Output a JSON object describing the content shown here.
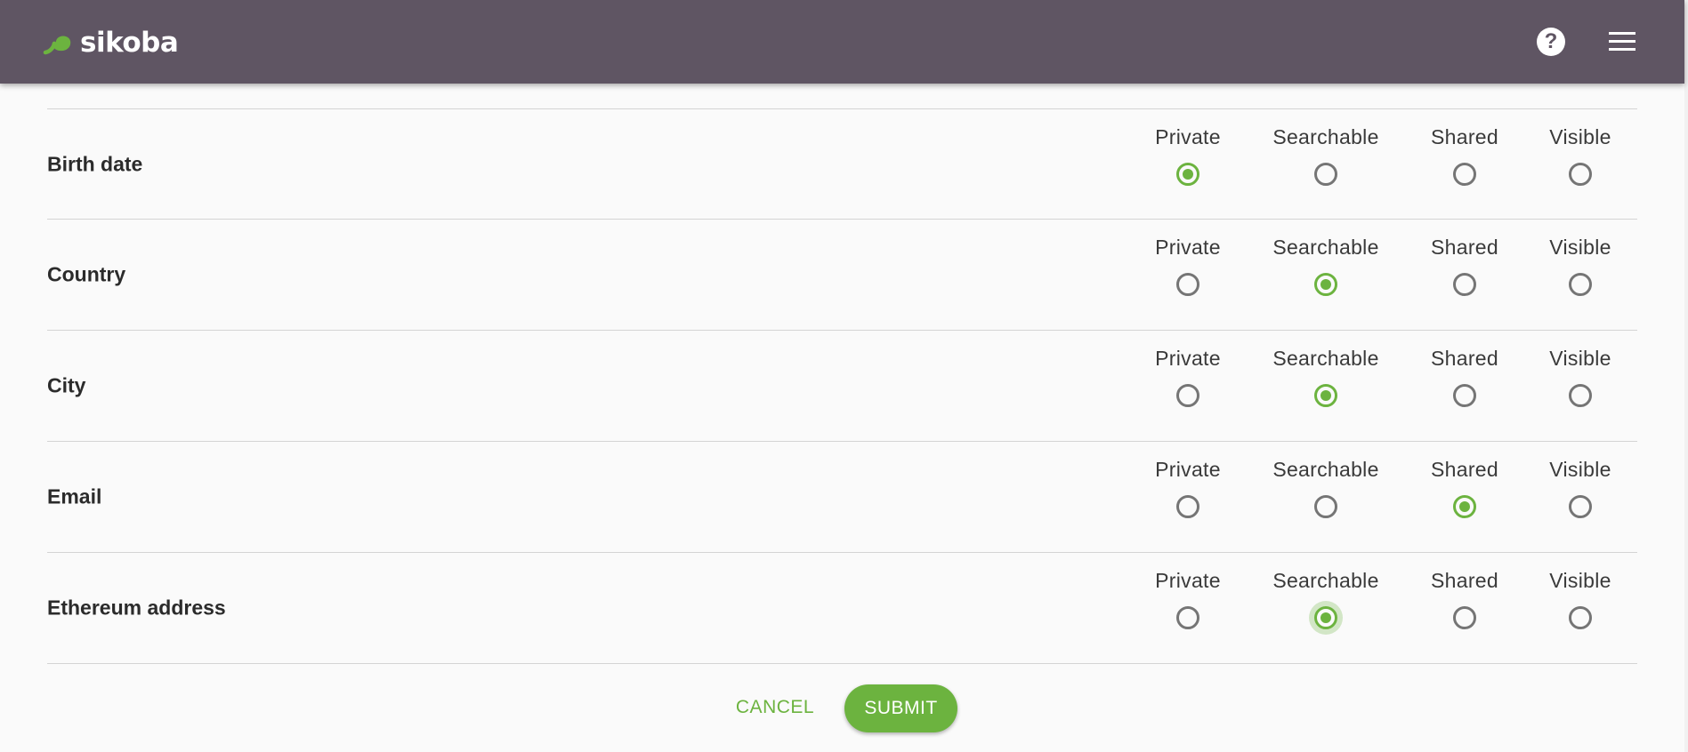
{
  "header": {
    "brand": "sikoba",
    "logo_icon": "spiral-logo-icon",
    "help_icon": "question-icon",
    "help_glyph": "?",
    "menu_icon": "hamburger-menu-icon"
  },
  "option_labels": [
    "Private",
    "Searchable",
    "Shared",
    "Visible"
  ],
  "fields": [
    {
      "label": "Birth date",
      "selected": "Private"
    },
    {
      "label": "Country",
      "selected": "Searchable"
    },
    {
      "label": "City",
      "selected": "Searchable"
    },
    {
      "label": "Email",
      "selected": "Shared"
    },
    {
      "label": "Ethereum address",
      "selected": "Searchable"
    }
  ],
  "rows": [
    {
      "label": "Birth date",
      "options": [
        "Private",
        "Searchable",
        "Shared",
        "Visible"
      ]
    },
    {
      "label": "Country",
      "options": [
        "Private",
        "Searchable",
        "Shared",
        "Visible"
      ]
    },
    {
      "label": "City",
      "options": [
        "Private",
        "Searchable",
        "Shared",
        "Visible"
      ]
    },
    {
      "label": "Email",
      "options": [
        "Private",
        "Searchable",
        "Shared",
        "Visible"
      ]
    },
    {
      "label": "Ethereum address",
      "options": [
        "Private",
        "Searchable",
        "Shared",
        "Visible"
      ]
    }
  ],
  "actions": {
    "cancel_label": "CANCEL",
    "submit_label": "SUBMIT"
  },
  "colors": {
    "header_bg": "#5f5563",
    "accent": "#6cb33f",
    "radio_off": "#757575"
  }
}
